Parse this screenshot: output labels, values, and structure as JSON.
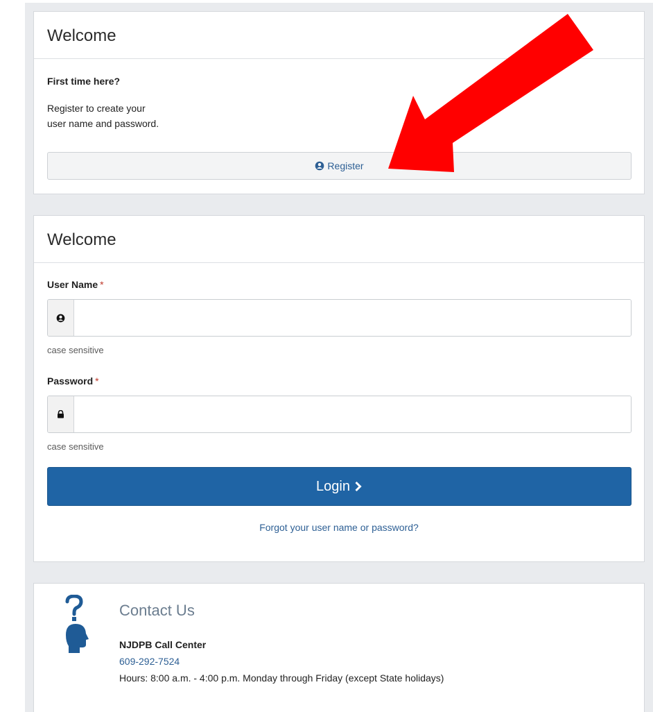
{
  "register_panel": {
    "title": "Welcome",
    "subtitle": "First time here?",
    "description_line1": "Register to create your",
    "description_line2": "user name and password.",
    "register_button": "Register"
  },
  "login_panel": {
    "title": "Welcome",
    "username_label": "User Name",
    "username_value": "",
    "username_hint": "case sensitive",
    "password_label": "Password",
    "password_value": "",
    "password_hint": "case sensitive",
    "required_marker": "*",
    "login_button": "Login",
    "forgot_link": "Forgot your user name or password?"
  },
  "contact_panel": {
    "title": "Contact Us",
    "call_center": "NJDPB Call Center",
    "phone": "609-292-7524",
    "hours": "Hours: 8:00 a.m. - 4:00 p.m. Monday through Friday (except State holidays)"
  },
  "icons": {
    "register": "user-icon",
    "username": "user-icon",
    "password": "lock-icon",
    "login": "chevron-right-icon",
    "contact": "help-head-icon",
    "annotation": "red-arrow-annotation"
  },
  "colors": {
    "primary": "#1f64a5",
    "link": "#2d5f94",
    "required": "#c0392b",
    "annotation_arrow": "#ff0000",
    "page_background": "#e9ebee"
  }
}
